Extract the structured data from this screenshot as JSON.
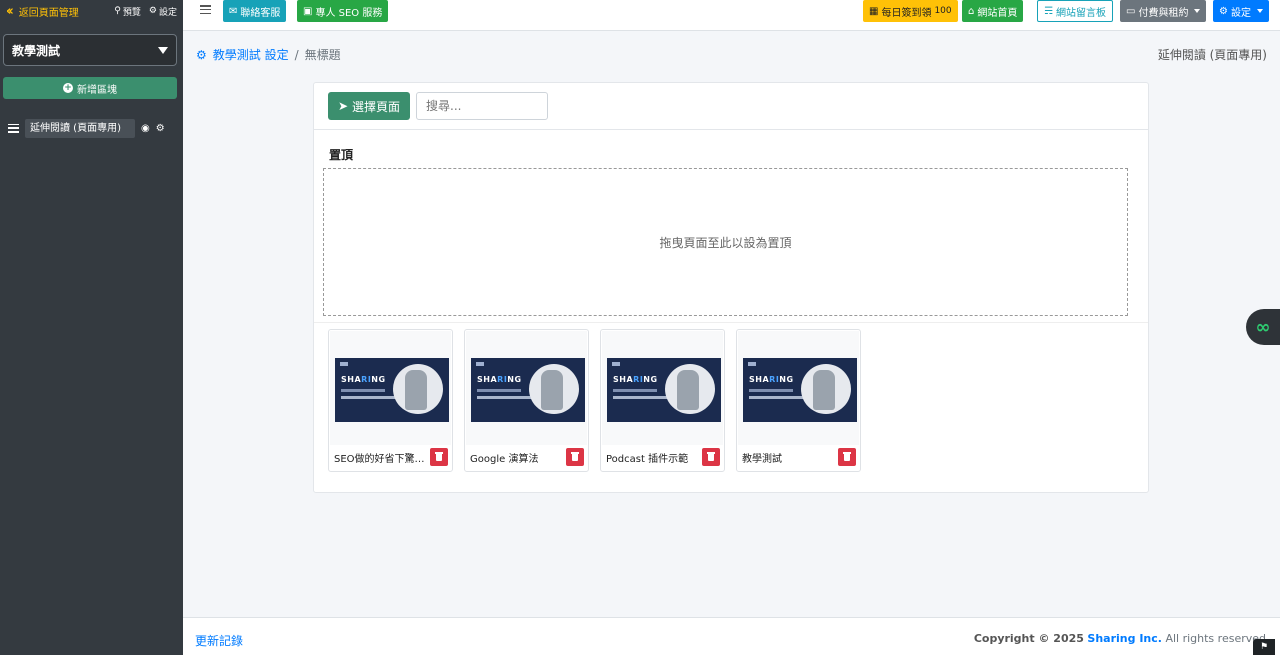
{
  "sidebar": {
    "back_label": "返回頁面管理",
    "preview_label": "預覽",
    "settings_label": "設定",
    "selected_page": "教學測試",
    "add_block_label": "新增區塊",
    "block_item_label": "延伸閱讀 (頁面專用)"
  },
  "topbar": {
    "contact_label": "聯絡客服",
    "seo_label": "專人 SEO 服務",
    "checkin_label": "每日簽到領",
    "checkin_count": "100",
    "home_label": "網站首頁",
    "guestbook_label": "網站留言板",
    "billing_label": "付費與租約",
    "settings_label": "設定"
  },
  "breadcrumb": {
    "root_label": "教學測試 設定",
    "current_label": "無標題"
  },
  "page_hint": "延伸閱讀 (頁面專用)",
  "main": {
    "select_page_label": "選擇頁面",
    "search_placeholder": "搜尋...",
    "pinned_title": "置頂",
    "drop_hint": "拖曳頁面至此以設為置頂",
    "thumb_brand_pre": "SHA",
    "thumb_brand_mid": "RI",
    "thumb_brand_post": "NG",
    "items": [
      {
        "name": "SEO做的好省下驚人..."
      },
      {
        "name": "Google 演算法"
      },
      {
        "name": "Podcast 插件示範"
      },
      {
        "name": "教學測試"
      }
    ]
  },
  "footer": {
    "changelog_label": "更新記錄",
    "copyright_pre": "Copyright © 2025",
    "company": "Sharing Inc.",
    "copyright_post": "All rights reserved"
  },
  "colors": {
    "sidebar_bg": "#343a40",
    "accent_green": "#3b8f6e",
    "link_blue": "#007bff",
    "danger": "#dc3545",
    "warning": "#ffc107"
  }
}
